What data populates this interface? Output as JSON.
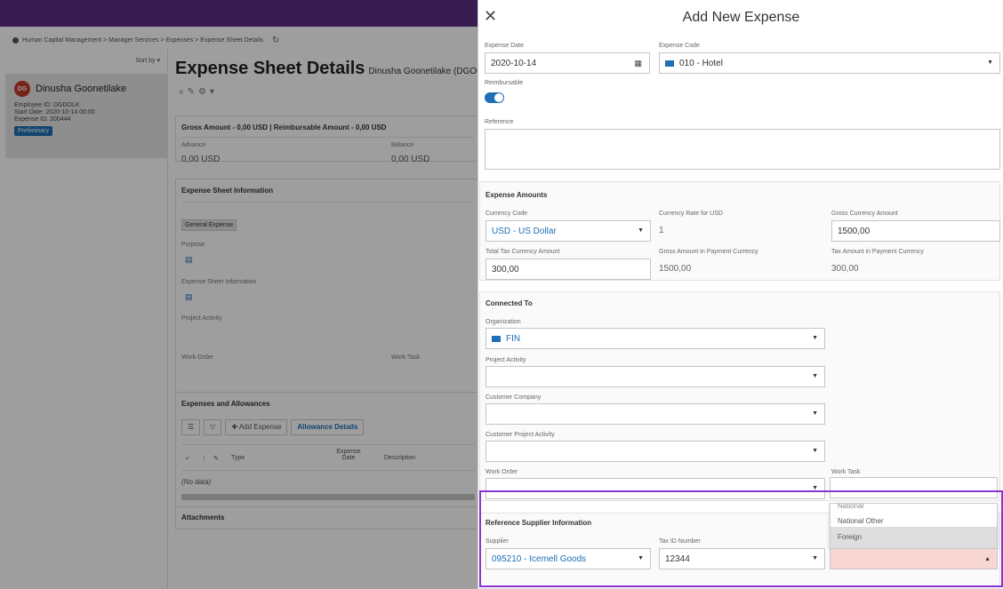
{
  "breadcrumb": {
    "path": "Human Capital Management > Manager Services > Expenses > Expense Sheet Details"
  },
  "left_panel": {
    "sort_label": "Sort by",
    "employee": {
      "initials": "DG",
      "name": "Dinusha Goonetilake",
      "employee_id": "Employee ID:  DGDOLK",
      "start_date": "Start Date:  2020-10-14 00:00",
      "expense_id": "Expense ID:  200444",
      "status": "Preliminary"
    }
  },
  "main": {
    "title": "Expense Sheet Details",
    "title_suffix": "Dinusha Goonetilake (DGOO",
    "gross_line": "Gross Amount - 0,00 USD | Reimbursable Amount - 0,00 USD",
    "advance_label": "Advance",
    "advance_value": "0,00 USD",
    "balance_label": "Balance",
    "balance_value": "0,00 USD",
    "info_head": "Expense Sheet Information",
    "general_badge": "General Expense",
    "purpose_label": "Purpose",
    "info_label": "Expense Sheet Information",
    "project_activity_label": "Project Activity",
    "work_order_label": "Work Order",
    "work_task_label": "Work Task",
    "expenses_head": "Expenses and Allowances",
    "add_expense": "Add Expense",
    "allowance_details": "Allowance Details",
    "col_type": "Type",
    "col_expense_date": "Expense Date",
    "col_description": "Description",
    "no_data": "(No data)",
    "attachments": "Attachments"
  },
  "modal": {
    "title": "Add New Expense",
    "expense_date_label": "Expense Date",
    "expense_date_value": "2020-10-14",
    "expense_code_label": "Expense Code",
    "expense_code_value": "010 - Hotel",
    "reimbursable_label": "Reimbursable",
    "reimbursable_on": true,
    "reference_label": "Reference",
    "amounts": {
      "head": "Expense Amounts",
      "currency_code_label": "Currency Code",
      "currency_code_value": "USD - US Dollar",
      "rate_label": "Currency Rate for USD",
      "rate_value": "1",
      "gross_label": "Gross Currency Amount",
      "gross_value": "1500,00",
      "tax_label": "Total Tax Currency Amount",
      "tax_value": "300,00",
      "gross_payment_label": "Gross Amount in Payment Currency",
      "gross_payment_value": "1500,00",
      "tax_payment_label": "Tax Amount in Payment Currency",
      "tax_payment_value": "300,00"
    },
    "connected": {
      "head": "Connected To",
      "organization_label": "Organization",
      "organization_value": "FIN",
      "project_activity_label": "Project Activity",
      "customer_company_label": "Customer Company",
      "customer_project_label": "Customer Project Activity",
      "work_order_label": "Work Order",
      "work_task_label": "Work Task"
    },
    "supplier": {
      "head": "Reference Supplier Information",
      "supplier_label": "Supplier",
      "supplier_value": "095210 - Icemell Goods",
      "tax_id_label": "Tax ID Number",
      "tax_id_value": "12344"
    },
    "dropdown_options": [
      "National",
      "National Other",
      "Foreign"
    ],
    "dropdown_selected": "Foreign"
  },
  "colors": {
    "topbar": "#5b2c83",
    "accent": "#1e6fb5",
    "focus_outline": "#8a35d0",
    "invalid_field": "#f8d7d3"
  }
}
